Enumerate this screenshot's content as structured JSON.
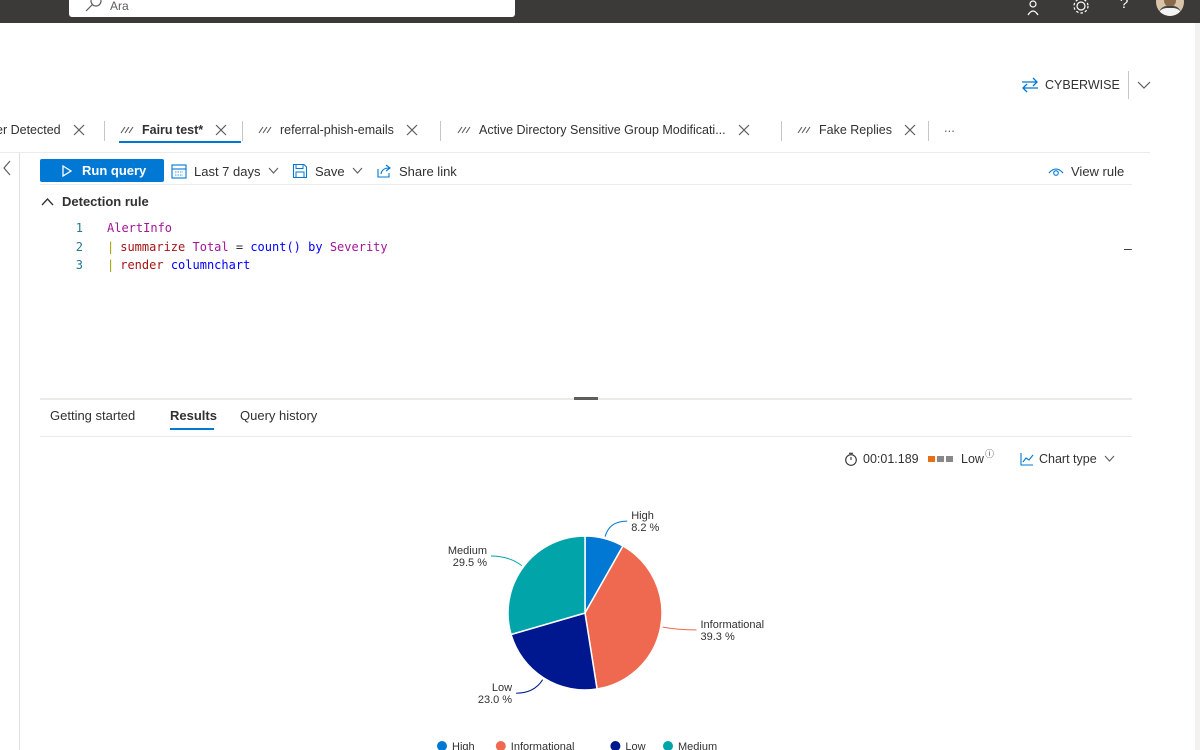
{
  "topbar": {
    "search_placeholder": "Ara",
    "help_label": "?"
  },
  "workspace": {
    "name": "CYBERWISE"
  },
  "tabs": [
    {
      "label": "er Detected",
      "active": false
    },
    {
      "label": "Fairu test*",
      "active": true
    },
    {
      "label": "referral-phish-emails",
      "active": false
    },
    {
      "label": "Active Directory Sensitive Group Modificati...",
      "active": false
    },
    {
      "label": "Fake Replies",
      "active": false
    }
  ],
  "tabs_more": "...",
  "toolbar": {
    "run_label": "Run query",
    "time_range": "Last 7 days",
    "save_label": "Save",
    "share_label": "Share link",
    "view_rule_label": "View rule"
  },
  "editor": {
    "section_title": "Detection rule",
    "lines": [
      {
        "n": "1",
        "table": "AlertInfo"
      },
      {
        "n": "2",
        "op": "summarize",
        "col": "Total",
        "eq": "=",
        "fn": "count()",
        "by": "by",
        "group": "Severity"
      },
      {
        "n": "3",
        "op": "render",
        "arg": "columnchart"
      }
    ]
  },
  "results_tabs": [
    {
      "label": "Getting started",
      "active": false
    },
    {
      "label": "Results",
      "active": true
    },
    {
      "label": "Query history",
      "active": false
    }
  ],
  "status": {
    "elapsed": "00:01.189",
    "resource_usage": "Low",
    "info_marker": "i",
    "chart_type_label": "Chart type"
  },
  "colors": {
    "accent": "#0078d4",
    "high": "#0078d4",
    "informational": "#ef6950",
    "low": "#00188f",
    "medium": "#00a4a9"
  },
  "chart_data": {
    "type": "pie",
    "categories": [
      "High",
      "Informational",
      "Low",
      "Medium"
    ],
    "values": [
      8.2,
      39.3,
      23.0,
      29.5
    ],
    "data_labels": [
      "8.2 %",
      "39.3 %",
      "23.0 %",
      "29.5 %"
    ],
    "colors": [
      "#0078d4",
      "#ef6950",
      "#00188f",
      "#00a4a9"
    ],
    "legend_position": "bottom",
    "title": ""
  }
}
